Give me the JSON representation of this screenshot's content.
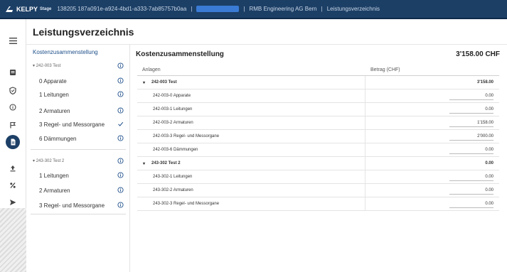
{
  "topbar": {
    "brand": "KELPY",
    "stage": "Stage",
    "session_id": "138205 187a091e-a924-4bd1-a333-7ab85757b0aa",
    "company": "RMB Engineering AG Bern",
    "module": "Leistungsverzeichnis"
  },
  "rail": {
    "icons": [
      "menu-icon",
      "inbox-icon",
      "shield-icon",
      "info-icon",
      "flag-icon",
      "document-icon",
      "upload-icon",
      "percent-icon",
      "send-icon"
    ]
  },
  "page": {
    "title": "Leistungsverzeichnis"
  },
  "nav": {
    "head": "Kostenzusammenstellung",
    "groups": [
      {
        "label": "242-003 Test",
        "status": "info",
        "items": [
          {
            "label": "0 Apparate",
            "status": "info"
          },
          {
            "label": "1 Leitungen",
            "status": "info"
          },
          {
            "label": "2 Armaturen",
            "status": "info"
          },
          {
            "label": "3 Regel- und Messorgane",
            "status": "check"
          },
          {
            "label": "6 Dämmungen",
            "status": "info"
          }
        ]
      },
      {
        "label": "243-302 Test 2",
        "status": "info",
        "items": [
          {
            "label": "1 Leitungen",
            "status": "info"
          },
          {
            "label": "2 Armaturen",
            "status": "info"
          },
          {
            "label": "3 Regel- und Messorgane",
            "status": "info"
          }
        ]
      }
    ]
  },
  "main": {
    "title": "Kostenzusammenstellung",
    "total": "3'158.00 CHF",
    "columns": {
      "name": "Anlagen",
      "amount": "Betrag (CHF)"
    },
    "rows": [
      {
        "kind": "group",
        "name": "242-003 Test",
        "amount": "3'158.00"
      },
      {
        "kind": "child",
        "name": "242-003-0 Apparate",
        "amount": "0.00"
      },
      {
        "kind": "child",
        "name": "242-003-1 Leitungen",
        "amount": "0.00"
      },
      {
        "kind": "child",
        "name": "242-003-2 Armaturen",
        "amount": "1'158.00"
      },
      {
        "kind": "child",
        "name": "242-003-3 Regel- und Messorgane",
        "amount": "2'000.00"
      },
      {
        "kind": "child",
        "name": "242-003-6 Dämmungen",
        "amount": "0.00"
      },
      {
        "kind": "group",
        "name": "243-302 Test 2",
        "amount": "0.00"
      },
      {
        "kind": "child",
        "name": "243-302-1 Leitungen",
        "amount": "0.00"
      },
      {
        "kind": "child",
        "name": "243-302-2 Armaturen",
        "amount": "0.00"
      },
      {
        "kind": "child",
        "name": "243-302-3 Regel- und Messorgane",
        "amount": "0.00"
      }
    ]
  },
  "colors": {
    "brand": "#1c3f66",
    "link": "#1e4f8a",
    "info": "#1e4f8a",
    "check": "#1e4f8a"
  }
}
